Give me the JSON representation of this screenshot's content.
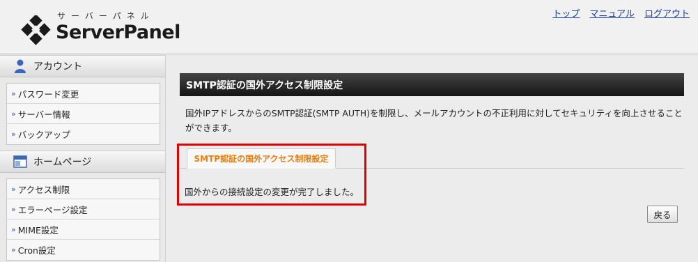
{
  "header": {
    "logo_sub": "サーバーパネル",
    "logo_title": "ServerPanel",
    "nav": [
      {
        "label": "トップ"
      },
      {
        "label": "マニュアル"
      },
      {
        "label": "ログアウト"
      }
    ]
  },
  "sidebar": {
    "account": {
      "title": "アカウント",
      "icon": "user-icon",
      "items": [
        {
          "label": "パスワード変更"
        },
        {
          "label": "サーバー情報"
        },
        {
          "label": "バックアップ"
        }
      ]
    },
    "homepage": {
      "title": "ホームページ",
      "icon": "window-icon",
      "items": [
        {
          "label": "アクセス制限"
        },
        {
          "label": "エラーページ設定"
        },
        {
          "label": "MIME設定"
        },
        {
          "label": "Cron設定"
        }
      ]
    }
  },
  "main": {
    "title": "SMTP認証の国外アクセス制限設定",
    "description": "国外IPアドレスからのSMTP認証(SMTP AUTH)を制限し、メールアカウントの不正利用に対してセキュリティを向上させることができます。",
    "tab_label": "SMTP認証の国外アクセス制限設定",
    "message": "国外からの接続設定の変更が完了しました。",
    "back_button": "戻る"
  },
  "colors": {
    "accent_tab": "#e67e10",
    "highlight": "#e30000",
    "link": "#1a3c9c",
    "title_bar": "#1f1f1f"
  }
}
